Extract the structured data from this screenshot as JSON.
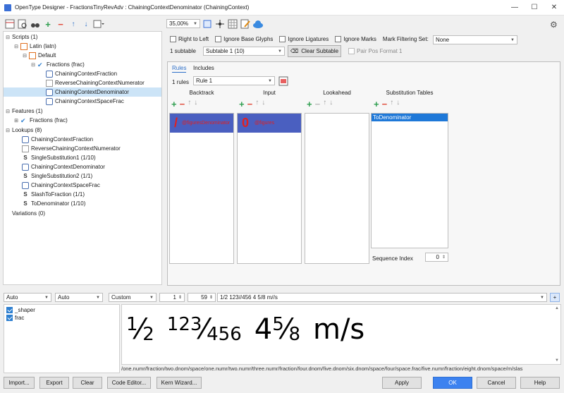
{
  "window": {
    "title": "OpenType Designer - FractionsTinyRevAdv : ChainingContextDenominator (ChainingContext)"
  },
  "toolbar": {
    "zoom": "35,00%"
  },
  "tree": [
    {
      "label": "Scripts (1)",
      "exp": "⊟",
      "icon": ""
    },
    {
      "label": "Latin (latn)",
      "exp": "⊟",
      "icon": "script"
    },
    {
      "label": "Default",
      "exp": "⊟",
      "icon": "script"
    },
    {
      "label": "Fractions (frac)",
      "exp": "⊟",
      "icon": "check"
    },
    {
      "label": "ChainingContextFraction",
      "exp": "",
      "icon": "ctx"
    },
    {
      "label": "ReverseChainingContextNumerator",
      "exp": "",
      "icon": "doc"
    },
    {
      "label": "ChainingContextDenominator",
      "exp": "",
      "icon": "ctx",
      "sel": true
    },
    {
      "label": "ChainingContextSpaceFrac",
      "exp": "",
      "icon": "ctx"
    },
    {
      "label": "Features (1)",
      "exp": "⊟",
      "icon": ""
    },
    {
      "label": "Fractions (frac)",
      "exp": "⊞",
      "icon": "check"
    },
    {
      "label": "Lookups (8)",
      "exp": "⊟",
      "icon": ""
    },
    {
      "label": "ChainingContextFraction",
      "exp": "",
      "icon": "ctx"
    },
    {
      "label": "ReverseChainingContextNumerator",
      "exp": "",
      "icon": "doc"
    },
    {
      "label": "SingleSubstitution1 (1/10)",
      "exp": "",
      "icon": "s"
    },
    {
      "label": "ChainingContextDenominator",
      "exp": "",
      "icon": "ctx"
    },
    {
      "label": "SingleSubstitution2 (1/1)",
      "exp": "",
      "icon": "s"
    },
    {
      "label": "ChainingContextSpaceFrac",
      "exp": "",
      "icon": "ctx"
    },
    {
      "label": "SlashToFraction (1/1)",
      "exp": "",
      "icon": "s"
    },
    {
      "label": "ToDenominator (1/10)",
      "exp": "",
      "icon": "s"
    },
    {
      "label": "Variations (0)",
      "exp": "",
      "icon": ""
    }
  ],
  "options": {
    "right_to_left": "Right to Left",
    "ignore_base": "Ignore Base Glyphs",
    "ignore_lig": "Ignore Ligatures",
    "ignore_marks": "Ignore Marks",
    "mark_filter_label": "Mark Filtering Set:",
    "mark_filter_value": "None"
  },
  "subtable": {
    "count": "1 subtable",
    "selected": "Subtable 1 (10)",
    "clear": "Clear Subtable",
    "pairpos": "Pair Pos Format 1"
  },
  "tabs": {
    "rules": "Rules",
    "includes": "Includes"
  },
  "rules": {
    "count": "1 rules",
    "selected": "Rule 1"
  },
  "columns": {
    "backtrack": "Backtrack",
    "input": "Input",
    "lookahead": "Lookahead",
    "subst": "Substitution Tables"
  },
  "backtrack_item": {
    "glyph": "/",
    "label": "@figuresDenominator"
  },
  "input_item": {
    "glyph": "0",
    "label": "@figures"
  },
  "subst_item": "ToDenominator",
  "sequence": {
    "label": "Sequence Index",
    "value": "0"
  },
  "preview": {
    "combo1": "Auto",
    "combo2": "Auto",
    "combo3": "Custom",
    "num1": "1",
    "num2": "59",
    "text": "1/2 123//456 4 5/8 m//s",
    "feat_shaper": "_shaper",
    "feat_frac": "frac",
    "glyphs": "/one.numr/fraction/two.dnom/space/one.numr/two.numr/three.numr/fraction/four.dnom/five.dnom/six.dnom/space/four/space.frac/five.numr/fraction/eight.dnom/space/m/slas",
    "display": {
      "f1n": "1",
      "f1d": "2",
      "f2n": "123",
      "f2d": "456",
      "f3w": "4",
      "f3n": "5",
      "f3d": "8",
      "unit": "m/s"
    }
  },
  "buttons": {
    "import": "Import...",
    "export": "Export",
    "clear": "Clear",
    "code": "Code Editor...",
    "kern": "Kern Wizard...",
    "apply": "Apply",
    "ok": "OK",
    "cancel": "Cancel",
    "help": "Help"
  },
  "colors": {
    "accent": "#3c82f0",
    "selection": "#4a5fc0",
    "red": "#e02020"
  }
}
